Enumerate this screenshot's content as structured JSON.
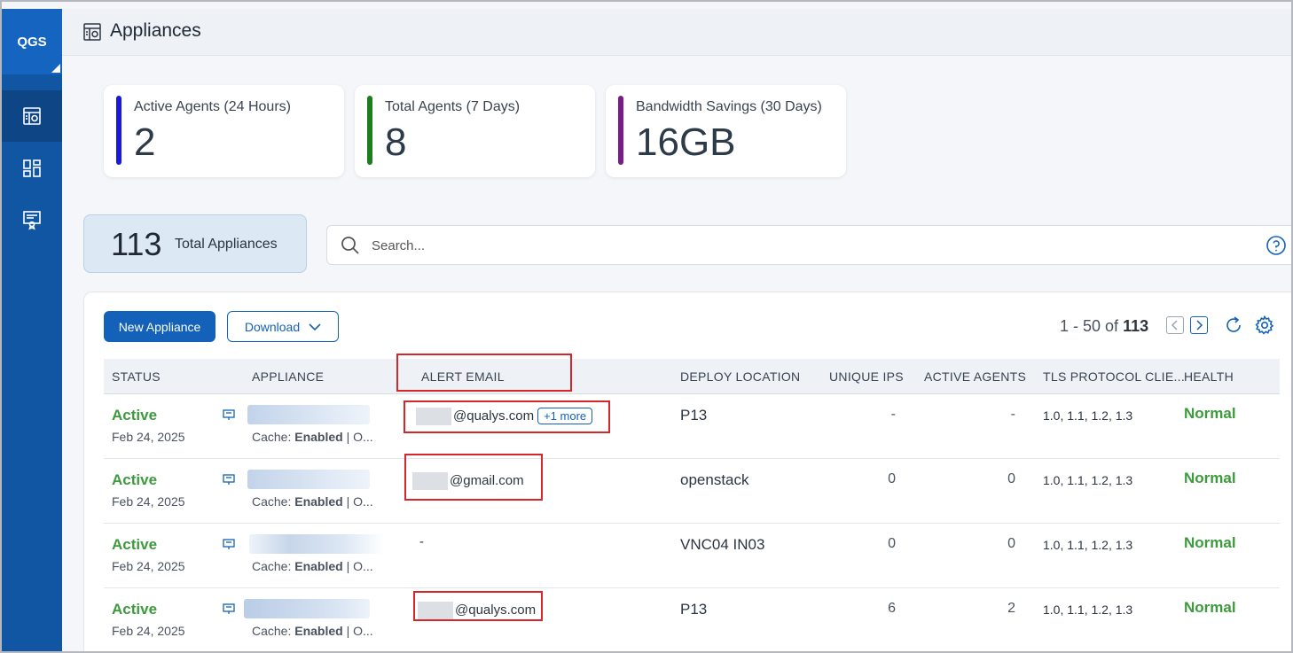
{
  "sidebar": {
    "brand": "QGS",
    "items": [
      {
        "icon": "appliances-icon",
        "active": true
      },
      {
        "icon": "dashboard-icon",
        "active": false
      },
      {
        "icon": "certificate-icon",
        "active": false
      }
    ]
  },
  "header": {
    "icon": "appliances-icon",
    "title": "Appliances"
  },
  "stats": [
    {
      "label": "Active Agents (24 Hours)",
      "value": "2",
      "color": "#1a1adb"
    },
    {
      "label": "Total Agents (7 Days)",
      "value": "8",
      "color": "#1b7d1b"
    },
    {
      "label": "Bandwidth Savings (30 Days)",
      "value": "16GB",
      "color": "#7b1a8a"
    }
  ],
  "total": {
    "count": "113",
    "label": "Total Appliances"
  },
  "search": {
    "placeholder": "Search..."
  },
  "toolbar": {
    "new_label": "New Appliance",
    "download_label": "Download",
    "pager_range": "1 - 50 of",
    "pager_total": "113"
  },
  "table": {
    "headers": [
      "STATUS",
      "APPLIANCE",
      "ALERT EMAIL",
      "DEPLOY LOCATION",
      "UNIQUE IPS",
      "ACTIVE AGENTS",
      "TLS PROTOCOL CLIE...",
      "HEALTH"
    ],
    "cache_label": "Cache:",
    "cache_value": "Enabled",
    "cache_suffix": "| O...",
    "rows": [
      {
        "status": "Active",
        "date": "Feb 24, 2025",
        "email": "@qualys.com",
        "more": "+1 more",
        "location": "P13",
        "unique_ips": "-",
        "active_agents": "-",
        "tls": "1.0, 1.1, 1.2, 1.3",
        "health": "Normal"
      },
      {
        "status": "Active",
        "date": "Feb 24, 2025",
        "email": "@gmail.com",
        "more": "",
        "location": "openstack",
        "unique_ips": "0",
        "active_agents": "0",
        "tls": "1.0, 1.1, 1.2, 1.3",
        "health": "Normal"
      },
      {
        "status": "Active",
        "date": "Feb 24, 2025",
        "email": "-",
        "more": "",
        "location": "VNC04 IN03",
        "unique_ips": "0",
        "active_agents": "0",
        "tls": "1.0, 1.1, 1.2, 1.3",
        "health": "Normal"
      },
      {
        "status": "Active",
        "date": "Feb 24, 2025",
        "email": "@qualys.com",
        "more": "",
        "location": "P13",
        "unique_ips": "6",
        "active_agents": "2",
        "tls": "1.0, 1.1, 1.2, 1.3",
        "health": "Normal"
      }
    ]
  },
  "colors": {
    "accent": "#1361b8",
    "status_ok": "#3d9a3d",
    "highlight": "#d6262a"
  }
}
